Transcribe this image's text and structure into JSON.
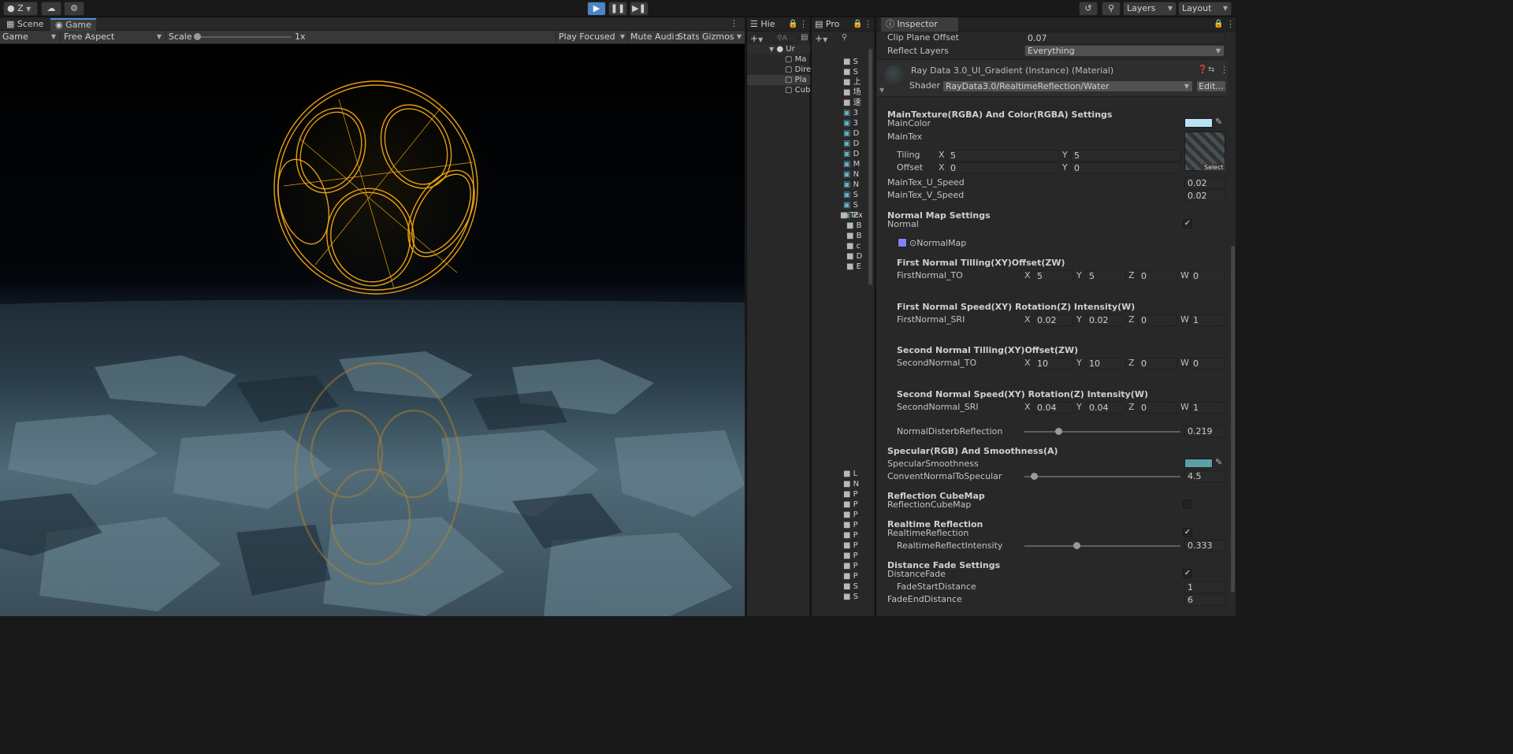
{
  "toolbar": {
    "account_label": "Z",
    "layers_label": "Layers",
    "layout_label": "Layout",
    "play_icon": "play-icon",
    "pause_icon": "pause-icon",
    "step_icon": "step-icon"
  },
  "game_view": {
    "tabs": [
      {
        "label": "Scene",
        "icon": "scene-icon"
      },
      {
        "label": "Game",
        "icon": "game-icon"
      }
    ],
    "display_label": "Game",
    "aspect_label": "Free Aspect",
    "scale_label": "Scale",
    "scale_value": "1x",
    "play_focused_label": "Play Focused",
    "mute_audio_label": "Mute Audio",
    "stats_label": "Stats",
    "gizmos_label": "Gizmos"
  },
  "hierarchy": {
    "tab_label": "Hie",
    "search_placeholder": "A",
    "scene_name": "Ur",
    "items": [
      "Ma",
      "Dire",
      "Pla",
      "Cub"
    ]
  },
  "project": {
    "tab_label": "Pro",
    "items_top": [
      "S",
      "S",
      "上",
      "场",
      "速",
      "3",
      "3",
      "D",
      "D",
      "D",
      "M",
      "N",
      "N",
      "S",
      "S",
      "Z"
    ],
    "tex_label": "Tex",
    "tex_children": [
      "B",
      "B",
      "c",
      "D",
      "E"
    ],
    "items_bottom": [
      "L",
      "N",
      "P",
      "P",
      "P",
      "P",
      "P",
      "P",
      "P",
      "P",
      "P",
      "S",
      "S"
    ]
  },
  "inspector": {
    "tab_label": "Inspector",
    "clip_plane_offset_label": "Clip Plane Offset",
    "clip_plane_offset_value": "0.07",
    "reflect_layers_label": "Reflect Layers",
    "reflect_layers_value": "Everything",
    "material_name": "Ray Data 3.0_UI_Gradient (Instance) (Material)",
    "shader_label": "Shader",
    "shader_value": "RayData3.0/RealtimeReflection/Water",
    "edit_button": "Edit...",
    "main_section": "MainTexture(RGBA) And Color(RGBA) Settings",
    "main_color_label": "MainColor",
    "main_color": "#b9e3f6",
    "main_tex_label": "MainTex",
    "tiling_label": "Tiling",
    "offset_label": "Offset",
    "tiling_x": "5",
    "tiling_y": "5",
    "offset_x": "0",
    "offset_y": "0",
    "select_label": "Select",
    "u_speed_label": "MainTex_U_Speed",
    "u_speed_value": "0.02",
    "v_speed_label": "MainTex_V_Speed",
    "v_speed_value": "0.02",
    "normal_section": "Normal Map Settings",
    "normal_label": "Normal",
    "normal_map_label": "NormalMap",
    "first_tiling_header": "First  Normal  Tilling(XY)Offset(ZW)",
    "first_to_label": "FirstNormal_TO",
    "first_to": [
      "5",
      "5",
      "0",
      "0"
    ],
    "first_speed_header": "First  Normal  Speed(XY)  Rotation(Z)  Intensity(W)",
    "first_sri_label": "FirstNormal_SRI",
    "first_sri": [
      "0.02",
      "0.02",
      "0",
      "1"
    ],
    "second_tiling_header": "Second  Normal  Tilling(XY)Offset(ZW)",
    "second_to_label": "SecondNormal_TO",
    "second_to": [
      "10",
      "10",
      "0",
      "0"
    ],
    "second_speed_header": "Second  Normal  Speed(XY)  Rotation(Z)  Intensity(W)",
    "second_sri_label": "SecondNormal_SRI",
    "second_sri": [
      "0.04",
      "0.04",
      "0",
      "1"
    ],
    "axis_labels": [
      "X",
      "Y",
      "Z",
      "W"
    ],
    "disturb_label": "NormalDisterbReflection",
    "disturb_value": "0.219",
    "disturb_fraction": 0.219,
    "specular_section": "Specular(RGB) And Smoothness(A)",
    "spec_smooth_label": "SpecularSmoothness",
    "spec_color": "#5aa0a4",
    "convert_label": "ConventNormalToSpecular",
    "convert_value": "4.5",
    "convert_fraction": 0.06,
    "cubemap_section": "Reflection CubeMap",
    "cubemap_label": "ReflectionCubeMap",
    "realtime_section": "Realtime Reflection",
    "realtime_label": "RealtimeReflection",
    "reflect_intensity_label": "RealtimeReflectIntensity",
    "reflect_intensity_value": "0.333",
    "reflect_intensity_fraction": 0.333,
    "distance_section": "Distance Fade Settings",
    "distance_label": "DistanceFade",
    "fade_start_label": "FadeStartDistance",
    "fade_start_value": "1",
    "fade_end_label": "FadeEndDistance",
    "fade_end_value": "6"
  }
}
